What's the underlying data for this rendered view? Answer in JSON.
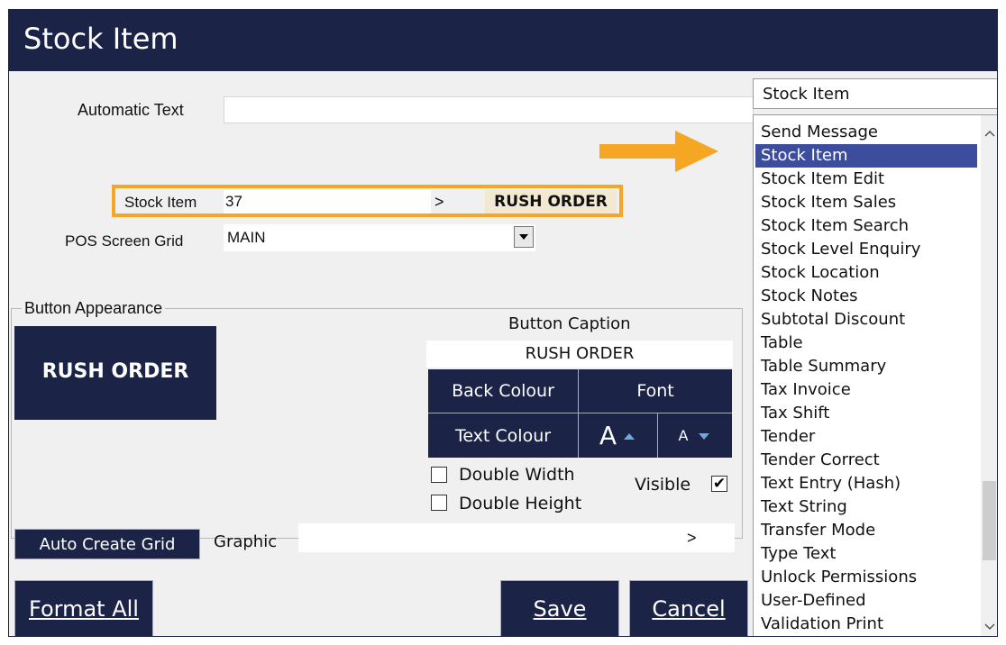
{
  "window": {
    "title": "Stock Item"
  },
  "form": {
    "automatic_text_label": "Automatic Text",
    "automatic_text_value": "",
    "stock_item_label": "Stock Item",
    "stock_item_value": "37",
    "stock_item_browse": ">",
    "stock_item_name": "RUSH ORDER",
    "pos_grid_label": "POS Screen Grid",
    "pos_grid_value": "MAIN"
  },
  "appearance": {
    "group_label": "Button Appearance",
    "preview_text": "RUSH ORDER",
    "caption_label": "Button Caption",
    "caption_value": "RUSH ORDER",
    "back_colour": "Back Colour",
    "font": "Font",
    "text_colour": "Text Colour",
    "font_up_glyph": "A",
    "font_down_glyph": "A",
    "double_width_label": "Double Width",
    "double_width_checked": false,
    "double_height_label": "Double Height",
    "double_height_checked": false,
    "visible_label": "Visible",
    "visible_checked": true,
    "auto_create_grid": "Auto Create Grid",
    "graphic_label": "Graphic",
    "graphic_value": "",
    "graphic_browse": ">"
  },
  "footer": {
    "format_all": "Format All",
    "save": "Save",
    "cancel": "Cancel"
  },
  "function_list": {
    "selected": "Stock Item",
    "items": [
      "Send Message",
      "Stock Item",
      "Stock Item Edit",
      "Stock Item Sales",
      "Stock Item Search",
      "Stock Level Enquiry",
      "Stock Location",
      "Stock Notes",
      "Subtotal Discount",
      "Table",
      "Table Summary",
      "Tax Invoice",
      "Tax Shift",
      "Tender",
      "Tender Correct",
      "Text Entry (Hash)",
      "Text String",
      "Transfer Mode",
      "Type Text",
      "Unlock Permissions",
      "User-Defined",
      "Validation Print"
    ],
    "highlight_color": "#3d4d9e"
  },
  "annotation": {
    "highlight_color": "#f5a623"
  }
}
